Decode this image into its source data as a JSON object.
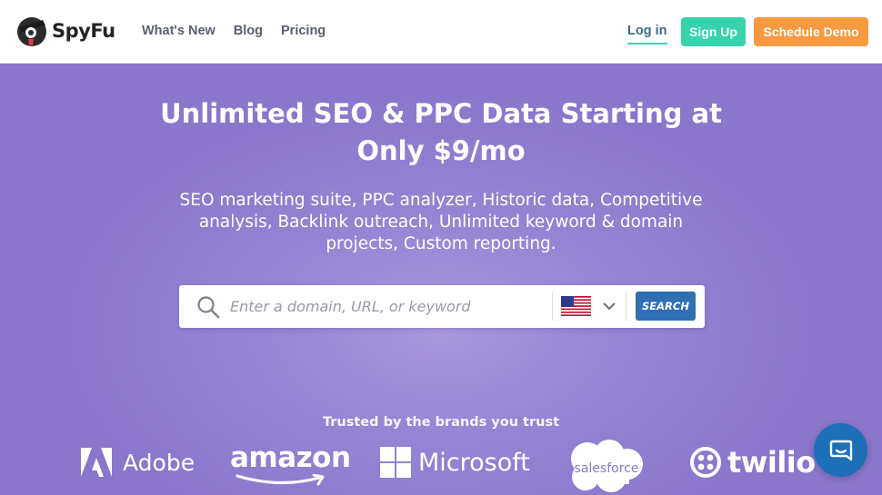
{
  "brand": {
    "name": "SpyFu"
  },
  "nav": {
    "items": [
      "What's New",
      "Blog",
      "Pricing"
    ]
  },
  "header_actions": {
    "login": "Log in",
    "signup": "Sign Up",
    "schedule_demo": "Schedule Demo"
  },
  "hero": {
    "title_line1": "Unlimited SEO & PPC Data Starting at",
    "title_line2": "Only $9/mo",
    "subtitle": "SEO marketing suite, PPC analyzer, Historic data, Competitive analysis, Backlink outreach, Unlimited keyword & domain projects, Custom reporting."
  },
  "search": {
    "placeholder": "Enter a domain, URL, or keyword",
    "value": "",
    "country_flag": "us-flag-icon",
    "button_label": "SEARCH"
  },
  "trusted": {
    "label": "Trusted by the brands you trust",
    "brands": [
      "Adobe",
      "amazon",
      "Microsoft",
      "salesforce",
      "twilio"
    ]
  },
  "colors": {
    "hero_bg": "#8a78cc",
    "signup": "#38d2ac",
    "demo": "#f79a42",
    "search_button": "#2f6fb3",
    "chat": "#1d6fb8"
  }
}
